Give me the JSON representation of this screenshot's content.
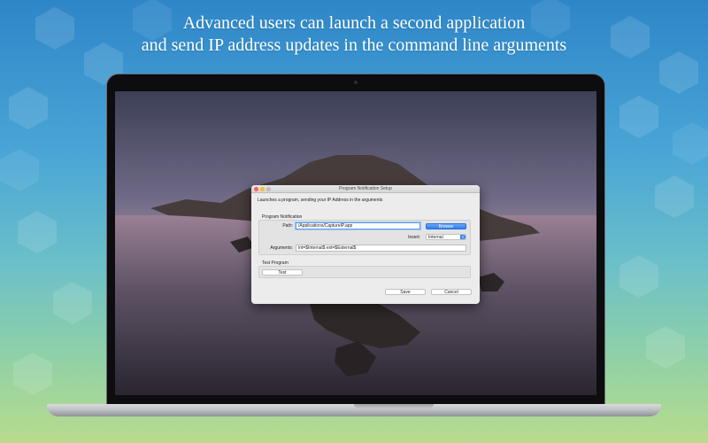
{
  "headline": {
    "line1": "Advanced users can launch a second application",
    "line2": "and send IP address updates in the command line arguments"
  },
  "dialog": {
    "title": "Program Notification Setup",
    "description": "Launches a program, sending your IP Address in the arguments",
    "program_notification": {
      "group_label": "Program Notification",
      "path_label": "Path:",
      "path_value": "/Applications/CaptureIP.app",
      "browse_label": "Browse",
      "insert_label": "Insert:",
      "insert_value": "Internal",
      "arguments_label": "Arguments:",
      "arguments_value": "int=$Internal$ ext=$External$"
    },
    "test_program": {
      "group_label": "Test Program",
      "test_label": "Test"
    },
    "save_label": "Save",
    "cancel_label": "Cancel"
  },
  "colors": {
    "accent": "#2d7ff0",
    "close": "#fc5f57",
    "minimize": "#fdbd2e"
  }
}
